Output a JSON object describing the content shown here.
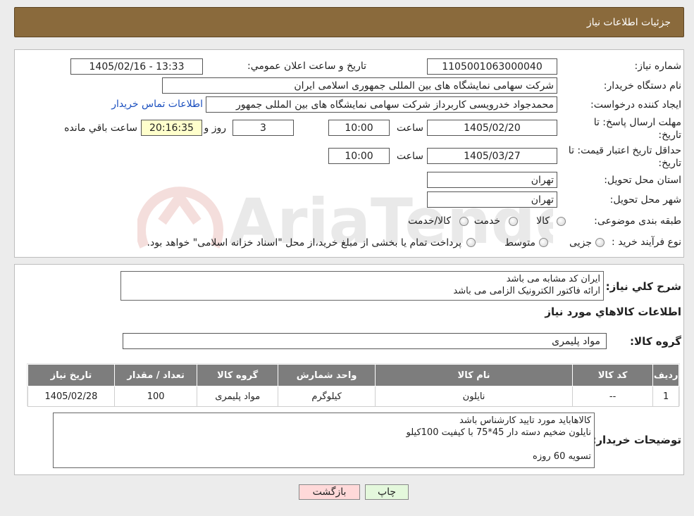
{
  "header": {
    "title": "جزئيات اطلاعات نياز"
  },
  "form": {
    "need_number_label": "شماره نیاز:",
    "need_number": "1105001063000040",
    "announce_label": "تاريخ و ساعت اعلان عمومي:",
    "announce_value": "1405/02/16 - 13:33",
    "buyer_org_label": "نام دستگاه خریدار:",
    "buyer_org": "شرکت سهامی نمایشگاه های بین المللی جمهوری اسلامی ایران",
    "creator_label": "ایجاد کننده درخواست:",
    "creator": "محمدجواد خدرویسی کاربرداز شرکت سهامی نمایشگاه های بین المللی جمهور",
    "contact_link": "اطلاعات تماس خریدار",
    "deadline_label": "مهلت ارسال پاسخ: تا تاریخ:",
    "deadline_date": "1405/02/20",
    "time_label": "ساعت",
    "deadline_time": "10:00",
    "days_value": "3",
    "days_label": "روز و",
    "remaining_value": "20:16:35",
    "remaining_label": "ساعت باقي مانده",
    "validity_label": "حداقل تاریخ اعتبار قیمت: تا تاریخ:",
    "validity_date": "1405/03/27",
    "validity_time": "10:00",
    "province_label": "استان محل تحویل:",
    "province": "تهران",
    "city_label": "شهر محل تحویل:",
    "city": "تهران",
    "category_label": "طبقه بندی موضوعی:",
    "category_options": [
      "کالا",
      "خدمت",
      "کالا/خدمت"
    ],
    "process_label": "نوع فرآیند خرید :",
    "process_options": [
      "جزیی",
      "متوسط"
    ],
    "process_note": "پرداخت تمام یا بخشی از مبلغ خرید،از محل \"اسناد خزانه اسلامی\" خواهد بود."
  },
  "summary": {
    "label": "شرح كلي نياز:",
    "text": "ایران کد مشابه می باشد\nارائه فاکتور الکترونیک الزامی می باشد"
  },
  "goods": {
    "title": "اطلاعات كالاهاي مورد نياز",
    "group_label": "گروه کالا:",
    "group_value": "مواد پلیمری",
    "columns": [
      "رديف",
      "کد کالا",
      "نام کالا",
      "واحد شمارش",
      "گروه کالا",
      "تعداد / مقدار",
      "تاریخ نیاز"
    ],
    "rows": [
      [
        "1",
        "--",
        "نایلون",
        "کیلوگرم",
        "مواد پلیمری",
        "100",
        "1405/02/28"
      ]
    ]
  },
  "buyer_notes": {
    "label": "توضیحات خریدار:",
    "text": "کالاهاباید مورد تایید کارشناس باشد\nنایلون ضخیم دسته دار 45*75 با کیفیت 100کیلو\n\nتسویه 60 روزه"
  },
  "buttons": {
    "print": "چاپ",
    "back": "بازگشت"
  },
  "colors": {
    "header_bg": "#8a6a3c",
    "table_header_bg": "#7d7d7d",
    "back_button_bg": "#ffd9d9",
    "print_button_bg": "#e4f8dc",
    "link": "#1a4fbf"
  }
}
